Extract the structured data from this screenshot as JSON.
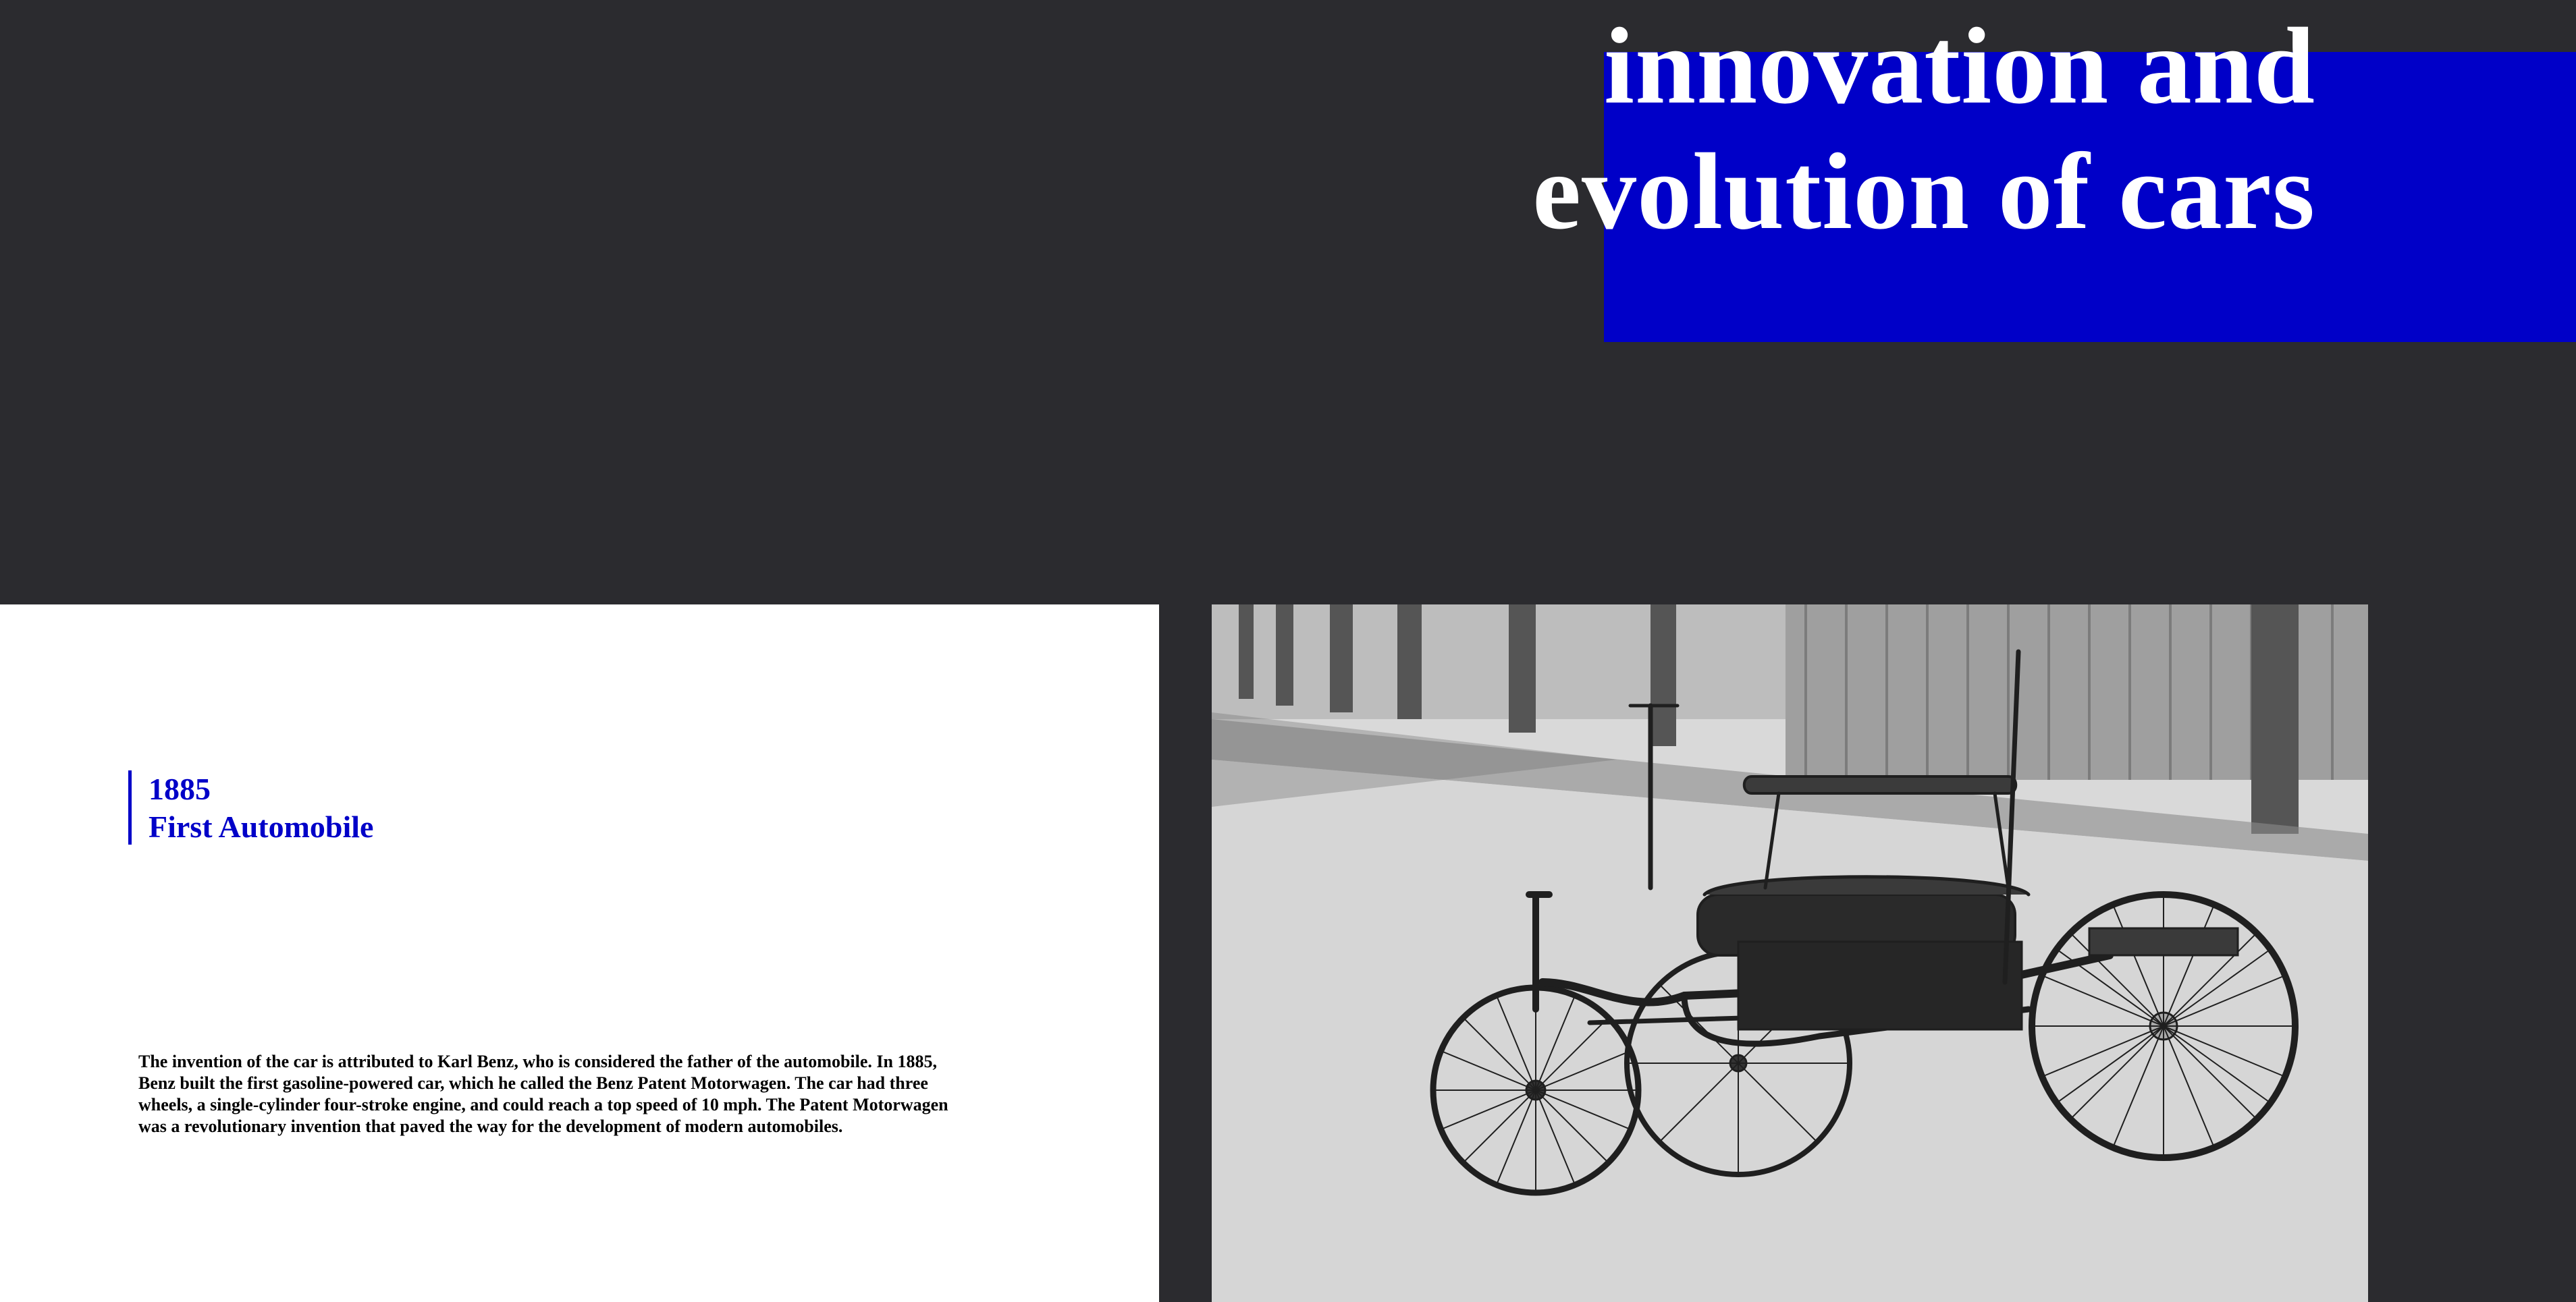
{
  "hero": {
    "title_line1": "innovation and",
    "title_line2": "evolution of cars"
  },
  "milestone": {
    "year": "1885",
    "heading": "First Automobile"
  },
  "description": "The invention of the car is attributed to Karl Benz, who is considered the father of the automobile. In 1885, Benz built the first gasoline-powered car, which he called the Benz Patent Motorwagen. The car had three wheels, a single-cylinder four-stroke engine, and could reach a top speed of 10 mph. The Patent Motorwagen was a revolutionary invention that paved the way for the development of modern automobiles.",
  "colors": {
    "background": "#2b2b2f",
    "accent": "#0000c8",
    "panel": "#ffffff"
  },
  "image": {
    "subject": "black-and-white photograph of the Benz Patent Motorwagen"
  }
}
